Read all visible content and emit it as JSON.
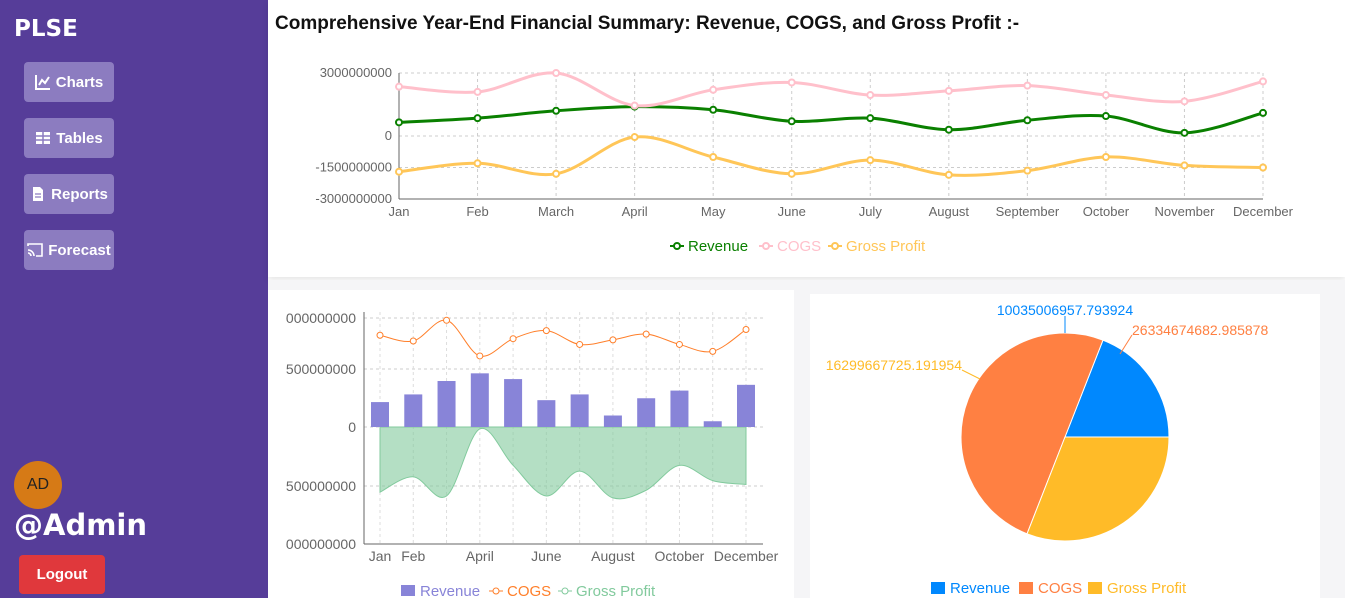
{
  "sidebar": {
    "brand": "PLSE",
    "nav": [
      {
        "label": "Charts",
        "icon": "line-chart-icon"
      },
      {
        "label": "Tables",
        "icon": "table-icon"
      },
      {
        "label": "Reports",
        "icon": "document-icon"
      },
      {
        "label": "Forecast",
        "icon": "cast-icon"
      }
    ],
    "avatar_initials": "AD",
    "username": "@Admin",
    "logout_label": "Logout"
  },
  "page": {
    "title": "Comprehensive Year-End Financial Summary: Revenue, COGS, and Gross Profit :-"
  },
  "colors": {
    "sidebar_bg": "#563d99",
    "nav_button_bg": "#8c7cc0",
    "logout_bg": "#e0383c",
    "avatar_bg": "#d67a16",
    "revenue_line": "#0a8000",
    "cogs_line": "#ffc0cb",
    "gross_profit_line": "#ffc658",
    "revenue_bar": "#8884d8",
    "cogs_orange": "#ff7f2a",
    "gross_profit_area": "#82ca9d",
    "pie_revenue": "#0088fe",
    "pie_cogs": "#ff8042",
    "pie_gross_profit": "#ffbb28"
  },
  "chart_data": [
    {
      "type": "line",
      "categories": [
        "Jan",
        "Feb",
        "March",
        "April",
        "May",
        "June",
        "July",
        "August",
        "September",
        "October",
        "November",
        "December"
      ],
      "series": [
        {
          "name": "Revenue",
          "values": [
            650000000,
            850000000,
            1200000000,
            1400000000,
            1250000000,
            700000000,
            850000000,
            300000000,
            750000000,
            950000000,
            150000000,
            1100000000
          ]
        },
        {
          "name": "COGS",
          "values": [
            2350000000,
            2100000000,
            3000000000,
            1450000000,
            2200000000,
            2550000000,
            1950000000,
            2150000000,
            2400000000,
            1950000000,
            1650000000,
            2600000000
          ]
        },
        {
          "name": "Gross Profit",
          "values": [
            -1700000000,
            -1300000000,
            -1800000000,
            -50000000,
            -1000000000,
            -1800000000,
            -1150000000,
            -1850000000,
            -1650000000,
            -1000000000,
            -1400000000,
            -1500000000
          ]
        }
      ],
      "yticks": [
        "3000000000",
        "0",
        "-1500000000",
        "-3000000000"
      ],
      "ylim": [
        -3000000000,
        3000000000
      ],
      "grid": true,
      "legend": "bottom"
    },
    {
      "type": "bar",
      "categories": [
        "Jan",
        "Feb",
        "March",
        "April",
        "May",
        "June",
        "July",
        "August",
        "September",
        "October",
        "November",
        "December"
      ],
      "x_tick_labels": [
        "Jan",
        "Feb",
        "April",
        "June",
        "August",
        "October",
        "December"
      ],
      "series": [
        {
          "name": "Revenue",
          "chart": "bar",
          "values": [
            650000000,
            850000000,
            1200000000,
            1400000000,
            1250000000,
            700000000,
            850000000,
            300000000,
            750000000,
            950000000,
            150000000,
            1100000000
          ]
        },
        {
          "name": "COGS",
          "chart": "line",
          "values": [
            2350000000,
            2100000000,
            3000000000,
            1450000000,
            2200000000,
            2550000000,
            1950000000,
            2150000000,
            2400000000,
            1950000000,
            1650000000,
            2600000000
          ]
        },
        {
          "name": "Gross Profit",
          "chart": "area",
          "values": [
            -1700000000,
            -1300000000,
            -1800000000,
            -50000000,
            -1000000000,
            -1800000000,
            -1150000000,
            -1850000000,
            -1650000000,
            -1000000000,
            -1400000000,
            -1500000000
          ]
        }
      ],
      "yticks": [
        "000000000",
        "500000000",
        "0",
        "500000000",
        "000000000"
      ],
      "ylim": [
        -3000000000,
        3000000000
      ],
      "grid": true,
      "legend": "bottom"
    },
    {
      "type": "pie",
      "slices": [
        {
          "name": "Revenue",
          "value": 10035006957.793924,
          "label": "10035006957.793924"
        },
        {
          "name": "COGS",
          "value": 26334674682.985878,
          "label": "26334674682.985878"
        },
        {
          "name": "Gross Profit",
          "value": 16299667725.191954,
          "label": "16299667725.191954"
        }
      ],
      "legend": "bottom"
    }
  ]
}
